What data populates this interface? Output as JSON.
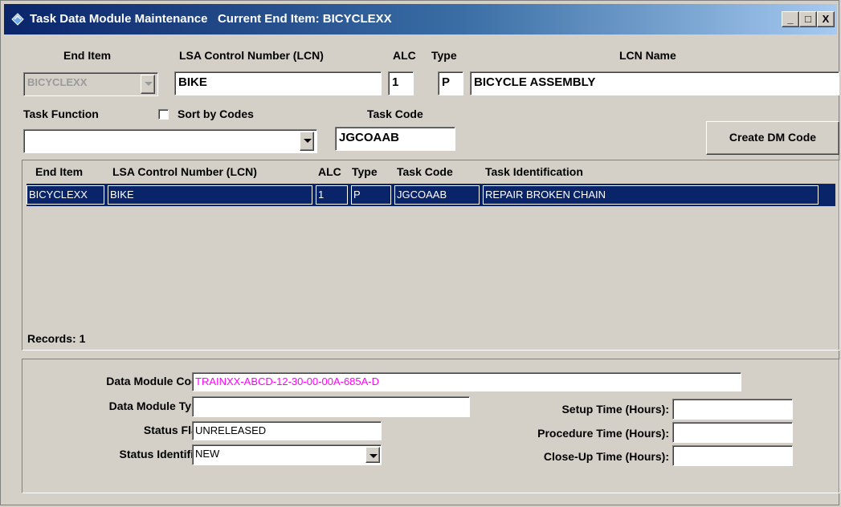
{
  "window": {
    "title": "Task Data Module Maintenance   Current End Item: BICYCLEXX",
    "buttons": {
      "minimize": "_",
      "maximize": "□",
      "close": "X"
    }
  },
  "header": {
    "end_item_label": "End Item",
    "end_item_value": "BICYCLEXX",
    "lcn_label": "LSA Control Number (LCN)",
    "lcn_value": "BIKE",
    "alc_label": "ALC",
    "alc_value": "1",
    "type_label": "Type",
    "type_value": "P",
    "lcn_name_label": "LCN Name",
    "lcn_name_value": "BICYCLE ASSEMBLY",
    "task_function_label": "Task Function",
    "task_function_value": "",
    "sort_by_codes_label": "Sort by Codes",
    "sort_by_codes_checked": false,
    "task_code_label": "Task Code",
    "task_code_value": "JGCOAAB",
    "create_dm_button": "Create DM Code"
  },
  "grid": {
    "columns": [
      "End Item",
      "LSA Control Number (LCN)",
      "ALC",
      "Type",
      "Task Code",
      "Task Identification"
    ],
    "rows": [
      [
        "BICYCLEXX",
        "BIKE",
        "1",
        "P",
        "JGCOAAB",
        "REPAIR BROKEN CHAIN"
      ]
    ],
    "records_label": "Records: 1"
  },
  "details": {
    "dm_code_label": "Data Module Code:",
    "dm_code_value": "TRAINXX-ABCD-12-30-00-00A-685A-D",
    "dm_code_color": "#ff00ff",
    "dm_type_label": "Data Module Type:",
    "dm_type_value": "",
    "status_flag_label": "Status Flag:",
    "status_flag_value": "UNRELEASED",
    "status_identifier_label": "Status Identifier:",
    "status_identifier_value": "NEW",
    "setup_time_label": "Setup Time (Hours):",
    "setup_time_value": "",
    "procedure_time_label": "Procedure Time (Hours):",
    "procedure_time_value": "",
    "closeup_time_label": "Close-Up Time (Hours):",
    "closeup_time_value": ""
  },
  "colors": {
    "titlebar_start": "#0a246a",
    "selection": "#0a246a",
    "window_bg": "#d4d0c8"
  }
}
